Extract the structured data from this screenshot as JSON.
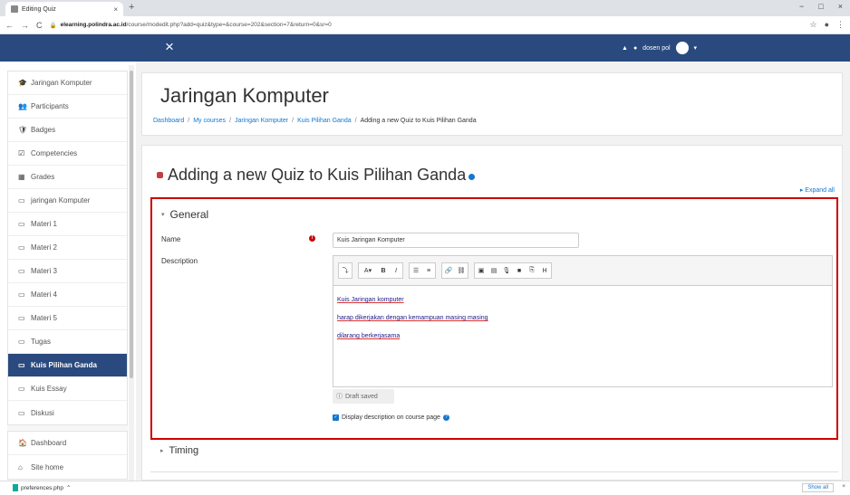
{
  "browser": {
    "tab_title": "Editing Quiz",
    "tab_close": "×",
    "new_tab": "+",
    "url_domain": "elearning.polindra.ac.id",
    "url_path": "/course/modedit.php?add=quiz&type=&course=202&section=7&return=0&sr=0",
    "window_controls": [
      "−",
      "□",
      "×"
    ]
  },
  "navbar": {
    "close_glyph": "×",
    "user_name": "dosen pol",
    "colors": {
      "bar": "#2a4a7f"
    }
  },
  "sidebar": {
    "group1": [
      {
        "icon": "🎓",
        "label": "Jaringan Komputer"
      },
      {
        "icon": "👥",
        "label": "Participants"
      },
      {
        "icon": "🛡",
        "label": "Badges"
      },
      {
        "icon": "☑",
        "label": "Competencies"
      },
      {
        "icon": "▦",
        "label": "Grades"
      },
      {
        "icon": "▭",
        "label": "jaringan Komputer"
      },
      {
        "icon": "▭",
        "label": "Materi 1"
      },
      {
        "icon": "▭",
        "label": "Materi 2"
      },
      {
        "icon": "▭",
        "label": "Materi 3"
      },
      {
        "icon": "▭",
        "label": "Materi 4"
      },
      {
        "icon": "▭",
        "label": "Materi 5"
      },
      {
        "icon": "▭",
        "label": "Tugas"
      },
      {
        "icon": "▭",
        "label": "Kuis Pilihan Ganda",
        "active": true
      },
      {
        "icon": "▭",
        "label": "Kuis Essay"
      },
      {
        "icon": "▭",
        "label": "Diskusi"
      }
    ],
    "group2": [
      {
        "icon": "🏠",
        "label": "Dashboard"
      },
      {
        "icon": "⌂",
        "label": "Site home"
      }
    ]
  },
  "header": {
    "title": "Jaringan Komputer",
    "breadcrumb": [
      "Dashboard",
      "My courses",
      "Jaringan Komputer",
      "Kuis Pilihan Ganda",
      "Adding a new Quiz to Kuis Pilihan Ganda"
    ],
    "breadcrumb_sep": "/"
  },
  "form": {
    "heading": "Adding a new Quiz to Kuis Pilihan Ganda",
    "expand_all": "Expand all",
    "general_title": "General",
    "name_label": "Name",
    "name_value": "Kuis Jaringan Komputer",
    "description_label": "Description",
    "description_lines": [
      "Kuis Jaringan komputer",
      "harap dikerjakan dengan kemampuan masing masing",
      "dilarang berkerjasama"
    ],
    "draft_saved": "Draft saved",
    "display_description": "Display description on course page",
    "timing_title": "Timing"
  },
  "downloads": {
    "file": "preferences.php",
    "show_all": "Show all"
  }
}
